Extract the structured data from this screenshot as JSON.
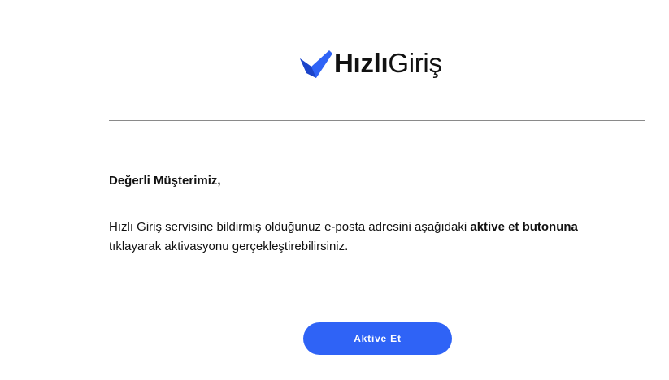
{
  "logo": {
    "bold": "Hızlı",
    "light": "Giriş",
    "icon": "check-icon",
    "icon_color": "#2f63f6"
  },
  "greeting": "Değerli Müşterimiz,",
  "message": {
    "part1": "Hızlı Giriş servisine bildirmiş olduğunuz e-posta adresini aşağıdaki ",
    "bold": "aktive et butonuna",
    "part2": " tıklayarak aktivasyonu gerçekleştirebilirsiniz."
  },
  "button": {
    "label": "Aktive Et",
    "color": "#2f63f6"
  }
}
